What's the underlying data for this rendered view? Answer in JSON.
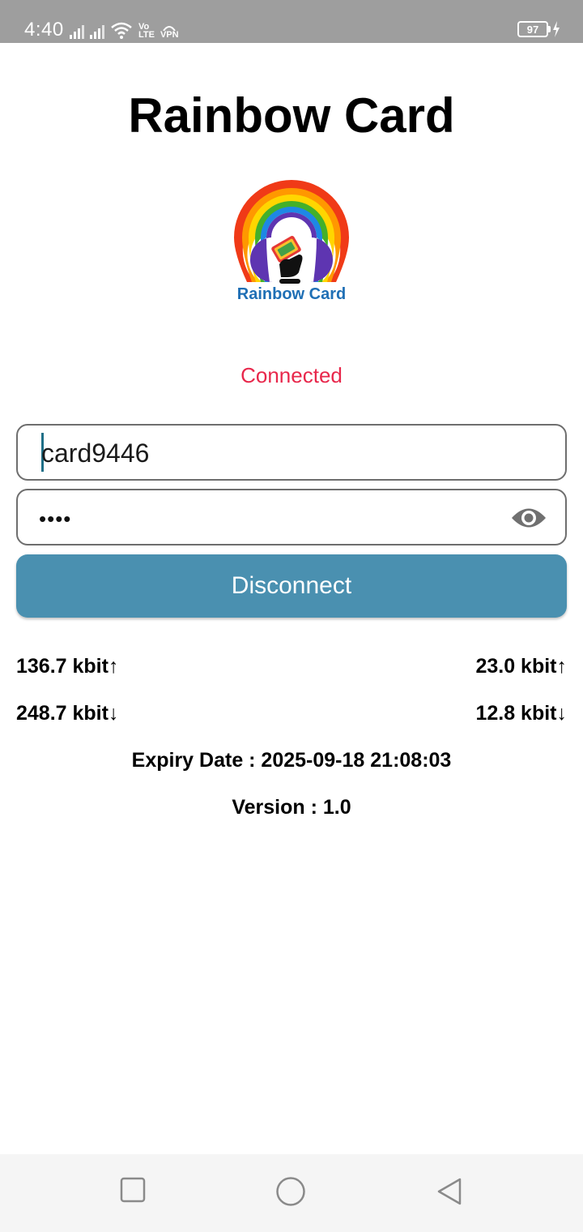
{
  "status_bar": {
    "time": "4:40",
    "network_label_top": "Vo",
    "network_label_bottom": "LTE",
    "vpn_label": "VPN",
    "battery": "97"
  },
  "app": {
    "title": "Rainbow Card",
    "logo_text": "Rainbow Card",
    "connection_status": "Connected",
    "status_color": "#e8274b",
    "accent_color": "#4a90b0"
  },
  "form": {
    "username_value": "card9446",
    "password_masked": "••••",
    "disconnect_label": "Disconnect"
  },
  "stats": {
    "upload_left": "136.7 kbit↑",
    "upload_right": "23.0 kbit↑",
    "download_left": "248.7 kbit↓",
    "download_right": "12.8 kbit↓"
  },
  "info": {
    "expiry": "Expiry Date : 2025-09-18 21:08:03",
    "version": "Version : 1.0"
  },
  "icons": {
    "wifi": "wifi-icon",
    "signal": "signal-icon",
    "eye": "eye-icon",
    "recent": "square-icon",
    "home": "circle-icon",
    "back": "triangle-back-icon"
  }
}
